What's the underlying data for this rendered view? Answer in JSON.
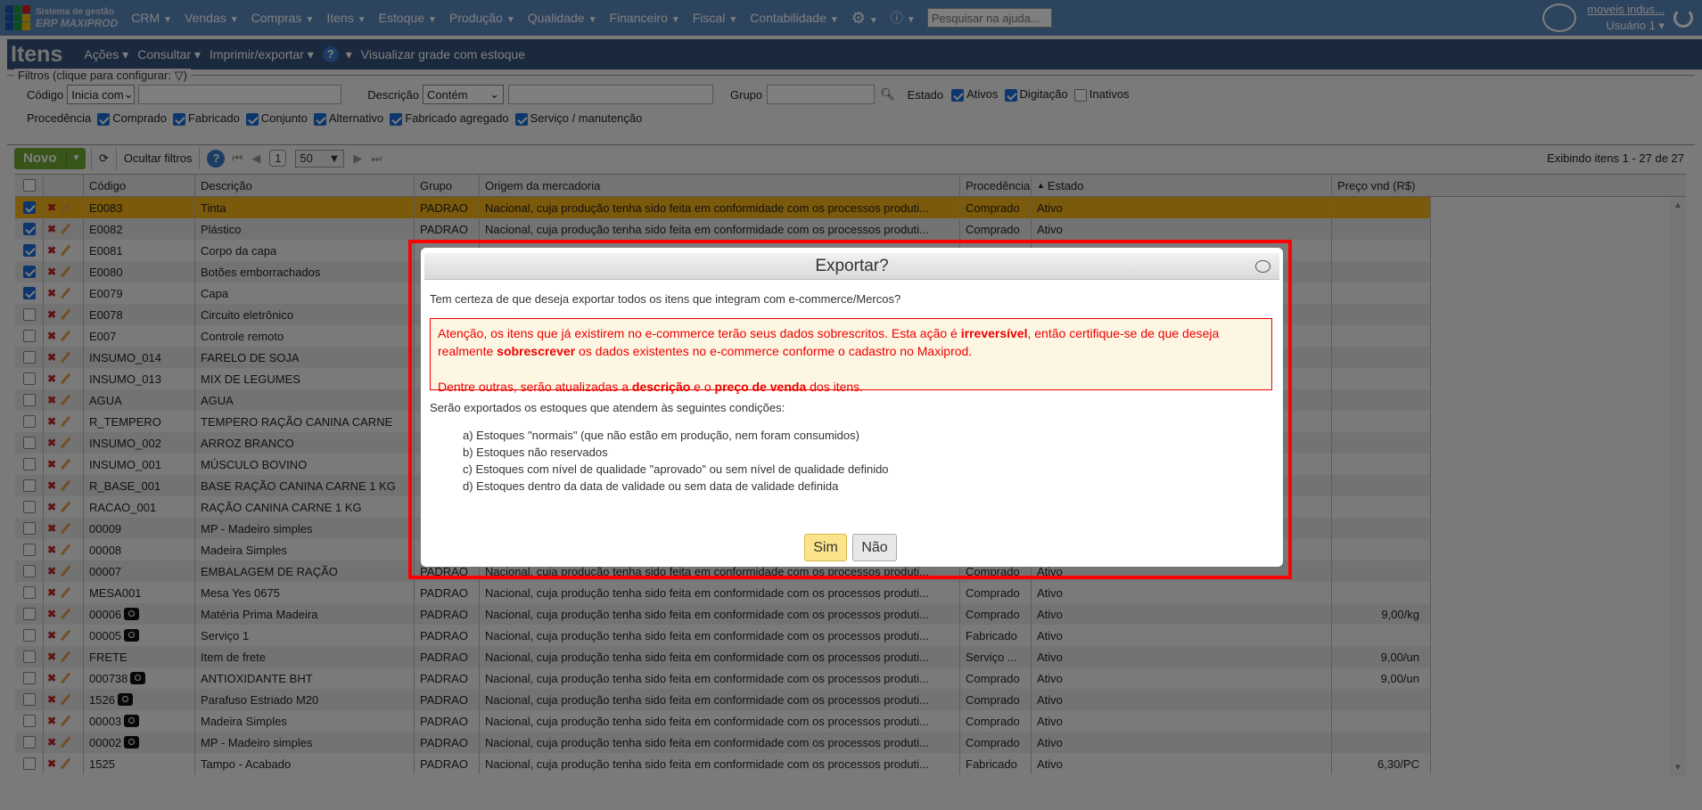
{
  "nav": {
    "brand_line1": "Sistema de gestão",
    "brand_line2": "ERP MAXIPROD",
    "items": [
      "CRM",
      "Vendas",
      "Compras",
      "Itens",
      "Estoque",
      "Produção",
      "Qualidade",
      "Financeiro",
      "Fiscal",
      "Contabilidade"
    ],
    "help_search_placeholder": "Pesquisar na ajuda...",
    "company": "moveis indus...",
    "user": "Usuário 1"
  },
  "page": {
    "title": "Itens",
    "menus": [
      "Ações",
      "Consultar",
      "Imprimir/exportar"
    ],
    "grid_link": "Visualizar grade com estoque"
  },
  "filters": {
    "legend": "Filtros (clique para configurar:",
    "legend_end": ")",
    "codigo_label": "Código",
    "codigo_mode": "Inicia com",
    "codigo_value": "",
    "descricao_label": "Descrição",
    "descricao_mode": "Contém",
    "descricao_value": "",
    "grupo_label": "Grupo",
    "grupo_value": "",
    "estado_label": "Estado",
    "estado": [
      {
        "label": "Ativos",
        "checked": true
      },
      {
        "label": "Digitação",
        "checked": true
      },
      {
        "label": "Inativos",
        "checked": false
      }
    ],
    "procedencia_label": "Procedência",
    "procedencia": [
      {
        "label": "Comprado",
        "checked": true
      },
      {
        "label": "Fabricado",
        "checked": true
      },
      {
        "label": "Conjunto",
        "checked": true
      },
      {
        "label": "Alternativo",
        "checked": true
      },
      {
        "label": "Fabricado agregado",
        "checked": true
      },
      {
        "label": "Serviço / manutenção",
        "checked": true
      }
    ]
  },
  "toolbar": {
    "new_label": "Novo",
    "hide_filters": "Ocultar filtros",
    "page": "1",
    "page_size": "50",
    "count": "Exibindo itens 1 - 27 de 27"
  },
  "table": {
    "columns": [
      "Código",
      "Descrição",
      "Grupo",
      "Origem da mercadoria",
      "Procedência",
      "Estado",
      "Preço vnd (R$)"
    ],
    "sort_column": "Estado",
    "rows": [
      {
        "checked": true,
        "selected": true,
        "code": "E0083",
        "desc": "Tinta",
        "group": "PADRAO",
        "origin": "Nacional, cuja produção tenha sido feita em conformidade com os processos produti...",
        "proc": "Comprado",
        "state": "Ativo",
        "price": ""
      },
      {
        "checked": true,
        "code": "E0082",
        "desc": "Plástico",
        "group": "PADRAO",
        "origin": "Nacional, cuja produção tenha sido feita em conformidade com os processos produti...",
        "proc": "Comprado",
        "state": "Ativo",
        "price": ""
      },
      {
        "checked": true,
        "code": "E0081",
        "desc": "Corpo da capa"
      },
      {
        "checked": true,
        "code": "E0080",
        "desc": "Botões emborrachados"
      },
      {
        "checked": true,
        "code": "E0079",
        "desc": "Capa"
      },
      {
        "code": "E0078",
        "desc": "Circuito eletrônico"
      },
      {
        "code": "E007",
        "desc": "Controle remoto"
      },
      {
        "code": "INSUMO_014",
        "desc": "FARELO DE SOJA"
      },
      {
        "code": "INSUMO_013",
        "desc": "MIX DE LEGUMES"
      },
      {
        "code": "AGUA",
        "desc": "AGUA"
      },
      {
        "code": "R_TEMPERO",
        "desc": "TEMPERO RAÇÃO CANINA CARNE"
      },
      {
        "code": "INSUMO_002",
        "desc": "ARROZ BRANCO"
      },
      {
        "code": "INSUMO_001",
        "desc": "MÚSCULO BOVINO"
      },
      {
        "code": "R_BASE_001",
        "desc": "BASE RAÇÃO CANINA CARNE 1 KG"
      },
      {
        "code": "RACAO_001",
        "desc": "RAÇÃO CANINA CARNE 1 KG"
      },
      {
        "code": "00009",
        "desc": "MP - Madeiro simples"
      },
      {
        "code": "00008",
        "desc": "Madeira Simples"
      },
      {
        "code": "00007",
        "desc": "EMBALAGEM DE RAÇÃO",
        "group": "PADRAO",
        "origin": "Nacional, cuja produção tenha sido feita em conformidade com os processos produti...",
        "proc": "Comprado",
        "state": "Ativo",
        "price": ""
      },
      {
        "code": "MESA001",
        "desc": "Mesa Yes 0675",
        "group": "PADRAO",
        "origin": "Nacional, cuja produção tenha sido feita em conformidade com os processos produti...",
        "proc": "Comprado",
        "state": "Ativo",
        "price": ""
      },
      {
        "code": "00006",
        "photo": true,
        "desc": "Matéria Prima Madeira",
        "group": "PADRAO",
        "origin": "Nacional, cuja produção tenha sido feita em conformidade com os processos produti...",
        "proc": "Comprado",
        "state": "Ativo",
        "price": "9,00/kg"
      },
      {
        "code": "00005",
        "photo": true,
        "desc": "Serviço 1",
        "group": "PADRAO",
        "origin": "Nacional, cuja produção tenha sido feita em conformidade com os processos produti...",
        "proc": "Fabricado",
        "state": "Ativo",
        "price": ""
      },
      {
        "code": "FRETE",
        "desc": "Item de frete",
        "group": "PADRAO",
        "origin": "Nacional, cuja produção tenha sido feita em conformidade com os processos produti...",
        "proc": "Serviço ...",
        "state": "Ativo",
        "price": "9,00/un"
      },
      {
        "code": "000738",
        "photo": true,
        "desc": "ANTIOXIDANTE BHT",
        "group": "PADRAO",
        "origin": "Nacional, cuja produção tenha sido feita em conformidade com os processos produti...",
        "proc": "Comprado",
        "state": "Ativo",
        "price": "9,00/un"
      },
      {
        "code": "1526",
        "photo": true,
        "desc": "Parafuso Estriado M20",
        "group": "PADRAO",
        "origin": "Nacional, cuja produção tenha sido feita em conformidade com os processos produti...",
        "proc": "Comprado",
        "state": "Ativo",
        "price": ""
      },
      {
        "code": "00003",
        "photo": true,
        "desc": "Madeira Simples",
        "group": "PADRAO",
        "origin": "Nacional, cuja produção tenha sido feita em conformidade com os processos produti...",
        "proc": "Comprado",
        "state": "Ativo",
        "price": ""
      },
      {
        "code": "00002",
        "photo": true,
        "desc": "MP - Madeiro simples",
        "group": "PADRAO",
        "origin": "Nacional, cuja produção tenha sido feita em conformidade com os processos produti...",
        "proc": "Comprado",
        "state": "Ativo",
        "price": ""
      },
      {
        "code": "1525",
        "desc": "Tampo - Acabado",
        "group": "PADRAO",
        "origin": "Nacional, cuja produção tenha sido feita em conformidade com os processos produti...",
        "proc": "Fabricado",
        "state": "Ativo",
        "price": "6,30/PC"
      }
    ]
  },
  "dialog": {
    "title": "Exportar?",
    "question": "Tem certeza de que deseja exportar todos os itens que integram com e-commerce/Mercos?",
    "warning": {
      "p1_a": "Atenção, os itens que já existirem no e-commerce terão seus dados sobrescritos. Esta ação é ",
      "p1_b": "irreversível",
      "p1_c": ", então certifique-se de que deseja realmente ",
      "p1_d": "sobrescrever",
      "p1_e": " os dados existentes no e-commerce conforme o cadastro no Maxiprod.",
      "p2_a": "Dentre outras, serão atualizadas a ",
      "p2_b": "descrição",
      "p2_c": " e o ",
      "p2_d": "preço de venda",
      "p2_e": " dos itens."
    },
    "conditions_intro": "Serão exportados os estoques que atendem às seguintes condições:",
    "conditions": [
      "a) Estoques \"normais\" (que não estão em produção, nem foram consumidos)",
      "b) Estoques não reservados",
      "c) Estoques com nível de qualidade \"aprovado\" ou sem nível de qualidade definido",
      "d) Estoques dentro da data de validade ou sem data de validade definida"
    ],
    "yes": "Sim",
    "no": "Não"
  },
  "colors": {
    "nav": "#5b88bf",
    "selected_row": "#f9b416",
    "new_button": "#6fa832",
    "warning_text": "#ee0000",
    "highlight_border": "#ff0000"
  }
}
